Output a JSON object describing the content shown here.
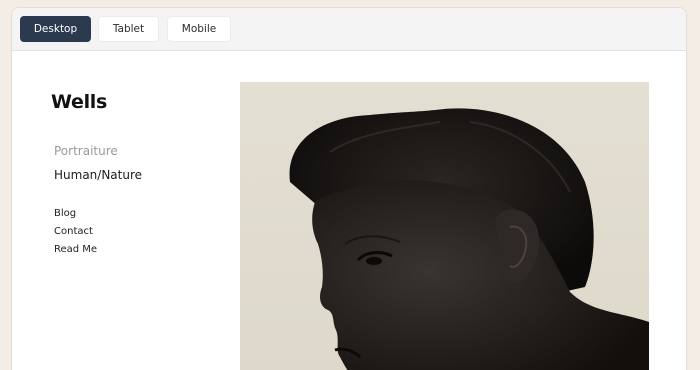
{
  "toolbar": {
    "buttons": [
      {
        "label": "Desktop",
        "active": true
      },
      {
        "label": "Tablet",
        "active": false
      },
      {
        "label": "Mobile",
        "active": false
      }
    ]
  },
  "site": {
    "title": "Wells",
    "nav_primary": [
      "Portraiture",
      "Human/Nature"
    ],
    "nav_secondary": [
      "Blog",
      "Contact",
      "Read Me"
    ]
  },
  "colors": {
    "active_button": "#2b3a4e",
    "page_background": "#f3ede6",
    "photo_background": "#e4e0d3"
  }
}
